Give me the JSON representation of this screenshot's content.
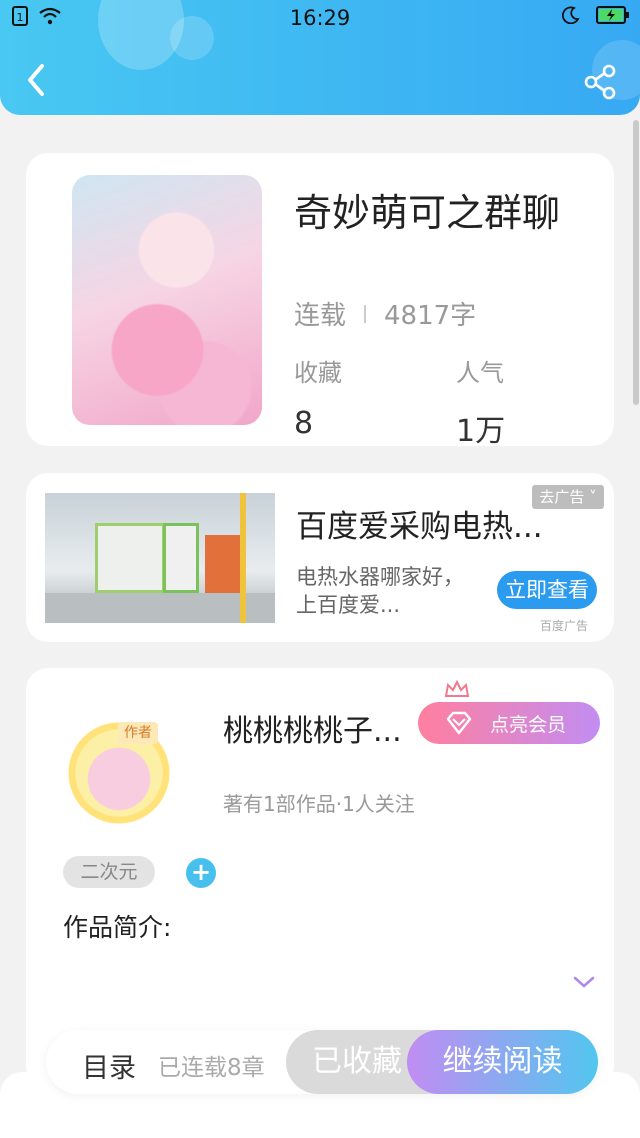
{
  "status_bar": {
    "time": "16:29",
    "icons": [
      "sim-icon",
      "wifi-icon",
      "moon-icon",
      "battery-charging-icon"
    ]
  },
  "header": {
    "back_icon": "chevron-left-icon",
    "share_icon": "share-icon"
  },
  "book": {
    "title": "奇妙萌可之群聊",
    "status": "连载",
    "word_count": "4817字",
    "stats": {
      "favorites_label": "收藏",
      "favorites_value": "8",
      "popularity_label": "人气",
      "popularity_value": "1万"
    }
  },
  "ad": {
    "title": "百度爱采购电热...",
    "description": "电热水器哪家好，上百度爱...",
    "tag": "去广告 ˅",
    "button": "立即查看",
    "source": "百度广告"
  },
  "author": {
    "badge": "作者",
    "name": "桃桃桃桃子...",
    "vip_button": "点亮会员",
    "stats": "著有1部作品·1人关注",
    "genre_tag": "二次元",
    "add_tag": "+",
    "intro_label": "作品简介:"
  },
  "bottom_bar": {
    "toc": "目录",
    "chapters": "已连载8章",
    "collected": "已收藏",
    "continue_reading": "继续阅读"
  },
  "colors": {
    "header_start": "#48c8f2",
    "header_end": "#37a9f3",
    "ad_button": "#2b9bf0",
    "vip_start": "#ff7f9f",
    "vip_end": "#c28df2",
    "read_start": "#c18df2",
    "read_end": "#52c6ef"
  }
}
